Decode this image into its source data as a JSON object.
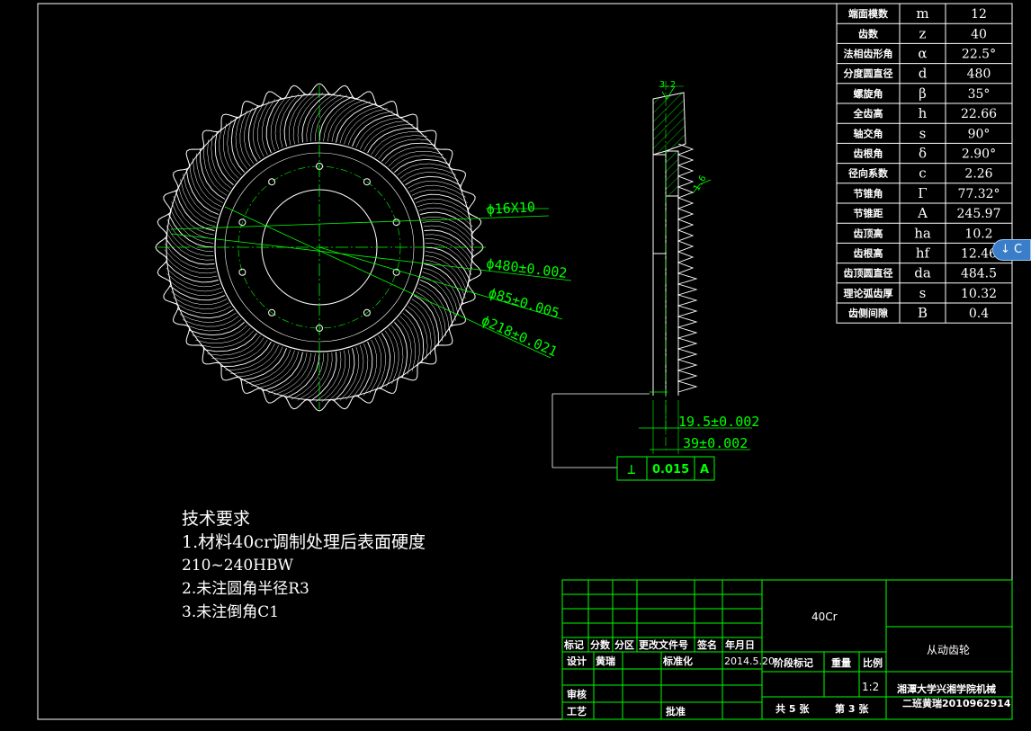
{
  "param_table": [
    {
      "name": "端面模数",
      "symbol": "m",
      "value": "12"
    },
    {
      "name": "齿数",
      "symbol": "z",
      "value": "40"
    },
    {
      "name": "法相齿形角",
      "symbol": "α",
      "value": "22.5°"
    },
    {
      "name": "分度圆直径",
      "symbol": "d",
      "value": "480"
    },
    {
      "name": "螺旋角",
      "symbol": "β",
      "value": "35°"
    },
    {
      "name": "全齿高",
      "symbol": "h",
      "value": "22.66"
    },
    {
      "name": "轴交角",
      "symbol": "s",
      "value": "90°"
    },
    {
      "name": "齿根角",
      "symbol": "δ",
      "value": "2.90°"
    },
    {
      "name": "径向系数",
      "symbol": "c",
      "value": "2.26"
    },
    {
      "name": "节锥角",
      "symbol": "Γ",
      "value": "77.32°"
    },
    {
      "name": "节锥距",
      "symbol": "A",
      "value": "245.97"
    },
    {
      "name": "齿顶高",
      "symbol": "ha",
      "value": "10.2"
    },
    {
      "name": "齿根高",
      "symbol": "hf",
      "value": "12.46"
    },
    {
      "name": "齿顶圆直径",
      "symbol": "da",
      "value": "484.5"
    },
    {
      "name": "理论弧齿厚",
      "symbol": "s",
      "value": "10.32"
    },
    {
      "name": "齿侧间隙",
      "symbol": "B",
      "value": "0.4"
    }
  ],
  "dimensions": {
    "hole": "ϕ16X10",
    "d480": "ϕ480±0.002",
    "d85": "ϕ85±0.005",
    "d218": "ϕ218±0.021",
    "len1": "19.5±0.002",
    "len2": "39±0.002",
    "roughness_top": "3.2",
    "roughness_side": "1.6"
  },
  "tolerance_frame": {
    "symbol": "⊥",
    "value": "0.015",
    "datum": "A"
  },
  "tech_requirements": {
    "title": "技术要求",
    "line1": "1.材料40cr调制处理后表面硬度",
    "line2": "210~240HBW",
    "line3": "2.未注圆角半径R3",
    "line4": "3.未注倒角C1"
  },
  "title_block": {
    "material": "40Cr",
    "part_name": "从动齿轮",
    "company_line1": "湘潭大学兴湘学院机械",
    "company_line2": "二班黄瑞2010962914",
    "headers": [
      "标记",
      "分数",
      "分区",
      "更改文件号",
      "签名",
      "年月日"
    ],
    "design_label": "设计",
    "designer": "黄瑞",
    "standard_label": "标准化",
    "date": "2014.5.20",
    "stage_label": "阶段标记",
    "weight_label": "重量",
    "scale_label": "比例",
    "scale": "1:2",
    "review_label": "审核",
    "process_label": "工艺",
    "approve_label": "批准",
    "sheets_total": "共 5 张",
    "sheet_no": "第 3 张"
  },
  "nav_button": {
    "icon": "arrow-down-icon",
    "label": "↓ C"
  }
}
